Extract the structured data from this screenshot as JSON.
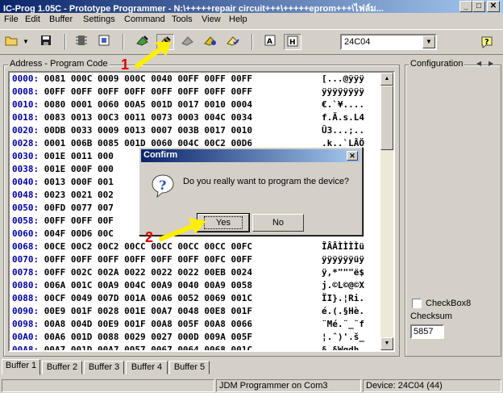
{
  "window": {
    "title": "IC-Prog 1.05C - Prototype Programmer - N:\\+++++repair circuit+++\\+++++eprom+++\\ไฟล์ม...",
    "min": "_",
    "max": "□",
    "close": "✕"
  },
  "menu": [
    "File",
    "Edit",
    "Buffer",
    "Settings",
    "Command",
    "Tools",
    "View",
    "Help"
  ],
  "toolbar": {
    "device": "24C04",
    "icons": [
      "open-file-icon",
      "save-icon",
      "chip-icon",
      "config-icon",
      "read-device-icon",
      "program-device-icon",
      "erase-icon",
      "verify-icon",
      "blank-check-icon",
      "view-hex-icon",
      "view-asm-icon",
      "help-icon"
    ]
  },
  "program_code": {
    "label": "Address - Program Code",
    "rows": [
      {
        "addr": "0000:",
        "hex": "0081 000C 0009 000C 0040 00FF 00FF 00FF",
        "ascii": "[...@ÿÿÿ"
      },
      {
        "addr": "0008:",
        "hex": "00FF 00FF 00FF 00FF 00FF 00FF 00FF 00FF",
        "ascii": "ÿÿÿÿÿÿÿÿ"
      },
      {
        "addr": "0010:",
        "hex": "0080 0001 0060 00A5 001D 0017 0010 0004",
        "ascii": "€.`¥...."
      },
      {
        "addr": "0018:",
        "hex": "0083 0013 00C3 0011 0073 0003 004C 0034",
        "ascii": "f.Ã.s.L4"
      },
      {
        "addr": "0020:",
        "hex": "00DB 0033 0009 0013 0007 003B 0017 0010",
        "ascii": "Û3...;.."
      },
      {
        "addr": "0028:",
        "hex": "0001 006B 0085 001D 0060 004C 00C2 00D6",
        "ascii": ".k..`LÂÖ"
      },
      {
        "addr": "0030:",
        "hex": "001E 0011 000",
        "ascii": ""
      },
      {
        "addr": "0038:",
        "hex": "001E 000F 000",
        "ascii": ""
      },
      {
        "addr": "0040:",
        "hex": "0013 000F 001",
        "ascii": ""
      },
      {
        "addr": "0048:",
        "hex": "0023 0021 002",
        "ascii": ""
      },
      {
        "addr": "0050:",
        "hex": "00FD 0077 007",
        "ascii": ""
      },
      {
        "addr": "0058:",
        "hex": "00FF 00FF 00F",
        "ascii": ""
      },
      {
        "addr": "0060:",
        "hex": "004F 00D6 00C",
        "ascii": ""
      },
      {
        "addr": "0068:",
        "hex": "00CE 00C2 00C2 00CC 00CC 00CC 00CC 00FC",
        "ascii": "ÎÂÂÌÌÌÌü"
      },
      {
        "addr": "0070:",
        "hex": "00FF 00FF 00FF 00FF 00FF 00FF 00FC 00FF",
        "ascii": "ÿÿÿÿÿÿüÿ"
      },
      {
        "addr": "0078:",
        "hex": "00FF 002C 002A 0022 0022 0022 00EB 0024",
        "ascii": "ÿ,*\"\"\"ë$"
      },
      {
        "addr": "0080:",
        "hex": "006A 001C 00A9 004C 00A9 0040 00A9 0058",
        "ascii": "j.©L©@©X"
      },
      {
        "addr": "0088:",
        "hex": "00CF 0049 007D 001A 00A6 0052 0069 001C",
        "ascii": "ÏI}.¦Ri."
      },
      {
        "addr": "0090:",
        "hex": "00E9 001F 0028 001E 00A7 0048 00E8 001F",
        "ascii": "é.(.§Hè."
      },
      {
        "addr": "0098:",
        "hex": "00A8 004D 00E9 001F 00A8 005F 00A8 0066",
        "ascii": "¨Mé.¨_¨f"
      },
      {
        "addr": "00A0:",
        "hex": "00A6 001D 0088 0029 0027 000D 009A 005F",
        "ascii": "¦.ˆ)'.š_"
      },
      {
        "addr": "00A8:",
        "hex": "00A7 001D 00A7 0057 0067 0064 0068 001C",
        "ascii": "§.§Wgdh."
      }
    ]
  },
  "config": {
    "label": "Configuration",
    "checkbox_label": "CheckBox8",
    "checksum_label": "Checksum",
    "checksum_value": "5857"
  },
  "dialog": {
    "title": "Confirm",
    "message": "Do you really want to program the device?",
    "yes": "Yes",
    "no": "No"
  },
  "annotations": {
    "one": "1",
    "two": "2"
  },
  "tabs": [
    "Buffer 1",
    "Buffer 2",
    "Buffer 3",
    "Buffer 4",
    "Buffer 5"
  ],
  "status": {
    "programmer": "JDM Programmer on Com3",
    "device": "Device: 24C04  (44)"
  },
  "colors": {
    "title_start": "#0a246a",
    "title_end": "#a6caf0",
    "address": "#0000a0",
    "annotation": "#e00000",
    "arrow": "#ffee00"
  }
}
